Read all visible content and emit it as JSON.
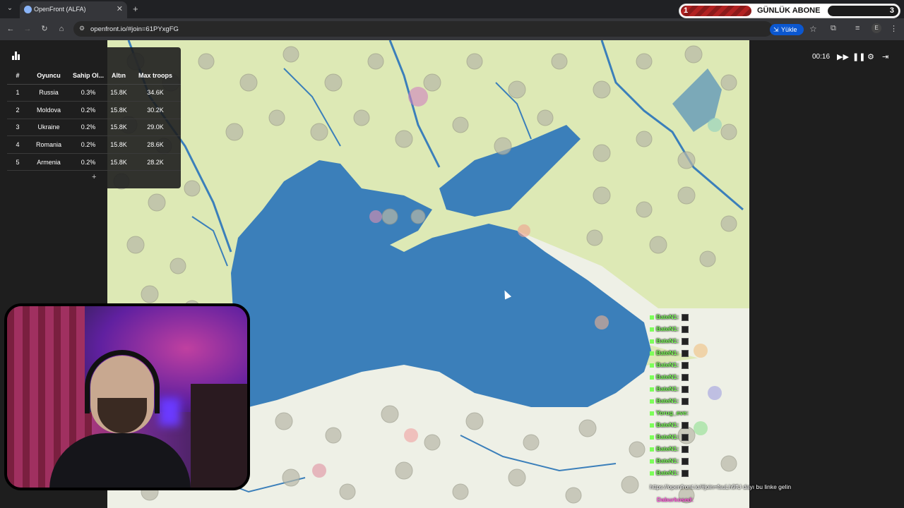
{
  "browser": {
    "tab_title": "OpenFront (ALFA)",
    "url": "openfront.io/#join=61PYxgFG",
    "install_label": "Yükle",
    "profile_initial": "E"
  },
  "overlay_banner": {
    "left_number": "1",
    "text": "GÜNLÜK ABONE",
    "right_number": "3"
  },
  "leaderboard": {
    "headers": [
      "#",
      "Oyuncu",
      "Sahip Ol...",
      "Altın",
      "Max troops"
    ],
    "rows": [
      {
        "rank": "1",
        "player": "Russia",
        "owned": "0.3%",
        "gold": "15.8K",
        "troops": "34.6K"
      },
      {
        "rank": "2",
        "player": "Moldova",
        "owned": "0.2%",
        "gold": "15.8K",
        "troops": "30.2K"
      },
      {
        "rank": "3",
        "player": "Ukraine",
        "owned": "0.2%",
        "gold": "15.8K",
        "troops": "29.0K"
      },
      {
        "rank": "4",
        "player": "Romania",
        "owned": "0.2%",
        "gold": "15.8K",
        "troops": "28.6K"
      },
      {
        "rank": "5",
        "player": "Armenia",
        "owned": "0.2%",
        "gold": "15.8K",
        "troops": "28.2K"
      }
    ],
    "expand_label": "+"
  },
  "game_controls": {
    "timer": "00:16"
  },
  "chat": {
    "messages": [
      {
        "name": "BateN1:"
      },
      {
        "name": "BateN1:"
      },
      {
        "name": "BateN1:"
      },
      {
        "name": "BateN1:"
      },
      {
        "name": "BateN1:"
      },
      {
        "name": "BateN1:"
      },
      {
        "name": "BateN1:"
      },
      {
        "name": "BateN1:"
      },
      {
        "name": "Yorug_eve:"
      },
      {
        "name": "BateN1:"
      },
      {
        "name": "BateN1:"
      },
      {
        "name": "BateN1:"
      },
      {
        "name": "BateN1:"
      },
      {
        "name": "BateN1:"
      }
    ],
    "long_message": "https://openfront.io/#join=fsuLh9fU dayı bu linke gelin",
    "last_name": "Daburkosed:"
  },
  "colors": {
    "sea": "#3b7fba",
    "land": "#dde9b5",
    "chat_name": "#7dff5a"
  }
}
